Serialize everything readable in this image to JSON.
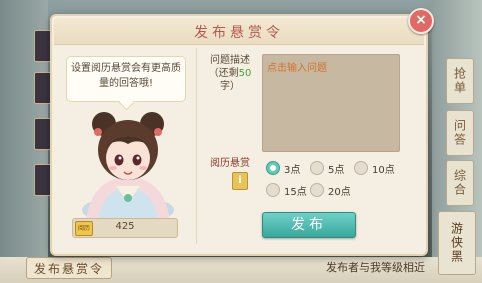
{
  "background": {
    "side_tabs": [
      "抢单",
      "问答",
      "综合"
    ],
    "bottom_tab": "发布悬赏令",
    "bottom_note": "发布者与我等级相近",
    "bottom_right_tab": "游侠黑"
  },
  "dialog": {
    "title": "发布悬赏令",
    "close_label": "×",
    "tip_text": "设置阅历悬赏会有更高质量的回答哦!",
    "currency": {
      "icon_label": "阅历",
      "value": "425"
    },
    "question": {
      "label_line1": "问题描述",
      "label_prefix": "（还剩",
      "remaining": "50",
      "label_suffix": "字）",
      "placeholder": "点击输入问题"
    },
    "reward": {
      "label": "阅历悬赏",
      "info_icon": "i",
      "options": [
        "3点",
        "5点",
        "10点",
        "15点",
        "20点"
      ],
      "selected": "3点"
    },
    "publish_label": "发布"
  },
  "colors": {
    "accent": "#3aa99d",
    "title": "#b35a50",
    "close": "#e06a63"
  }
}
